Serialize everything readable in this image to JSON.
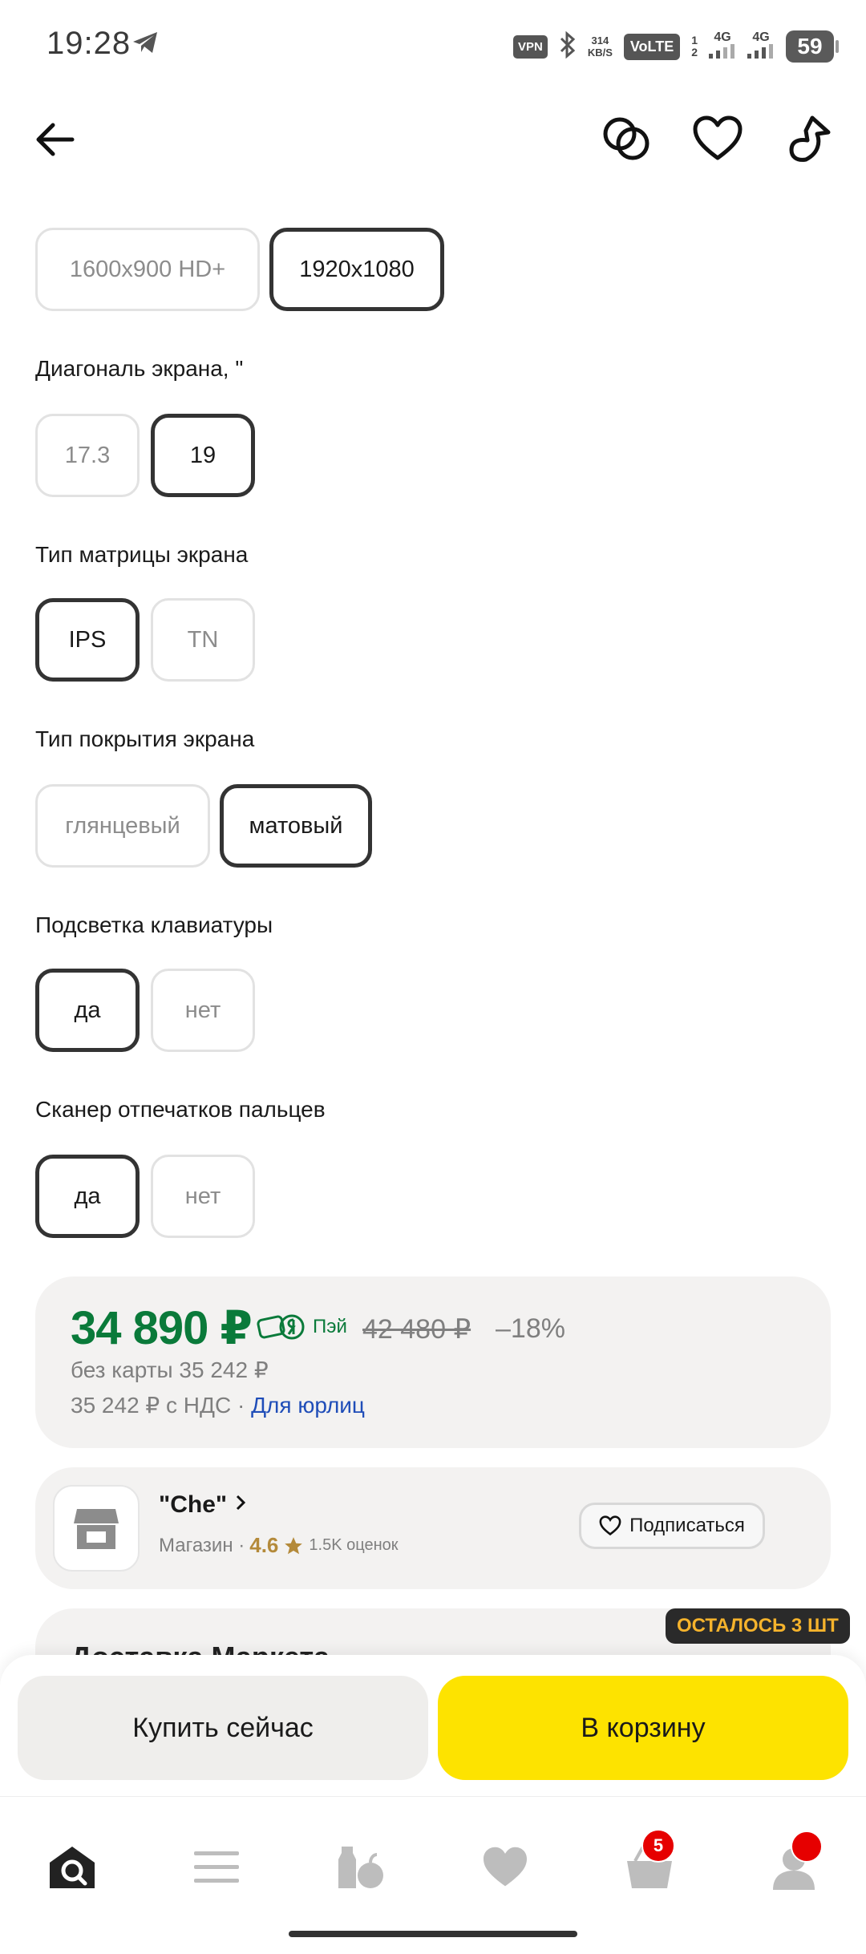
{
  "status_bar": {
    "time": "19:28",
    "vpn": "VPN",
    "speed_value": "314",
    "speed_unit": "KB/S",
    "volte": "VoLTE",
    "sim1": "1",
    "sim2": "2",
    "net1": "4G",
    "net2": "4G",
    "battery": "59"
  },
  "resolution": {
    "options": [
      "1600x900 HD+",
      "1920x1080"
    ],
    "selected": "1920x1080"
  },
  "diagonal": {
    "label": "Диагональ экрана, \"",
    "options": [
      "17.3",
      "19"
    ],
    "selected": "19"
  },
  "matrix": {
    "label": "Тип матрицы экрана",
    "options": [
      "IPS",
      "TN"
    ],
    "selected": "IPS"
  },
  "coating": {
    "label": "Тип покрытия экрана",
    "options": [
      "глянцевый",
      "матовый"
    ],
    "selected": "матовый"
  },
  "backlight": {
    "label": "Подсветка клавиатуры",
    "options": [
      "да",
      "нет"
    ],
    "selected": "да"
  },
  "fingerprint": {
    "label": "Сканер отпечатков пальцев",
    "options": [
      "да",
      "нет"
    ],
    "selected": "да"
  },
  "price": {
    "main": "34 890 ₽",
    "pay_label": "Пэй",
    "old": "42 480 ₽",
    "discount": "–18%",
    "no_card": "без карты 35 242 ₽",
    "vat": "35 242 ₽ с НДС · ",
    "vat_link": "Для юрлиц"
  },
  "shop": {
    "name": "\"Che\"",
    "type": "Магазин · ",
    "rating": "4.6",
    "reviews": "1.5K оценок",
    "subscribe": "Подписаться"
  },
  "delivery": {
    "title": "Доставка Маркета",
    "stock_badge": "ОСТАЛОСЬ 3 ШТ"
  },
  "actions": {
    "buy_now": "Купить сейчас",
    "to_cart": "В корзину"
  },
  "tabbar": {
    "cart_count": "5"
  },
  "colors": {
    "price_green": "#0a7a3a",
    "cart_yellow": "#fde300",
    "badge_red": "#e60000",
    "link_blue": "#1f4db8",
    "stock_badge_text": "#f5b32c"
  }
}
